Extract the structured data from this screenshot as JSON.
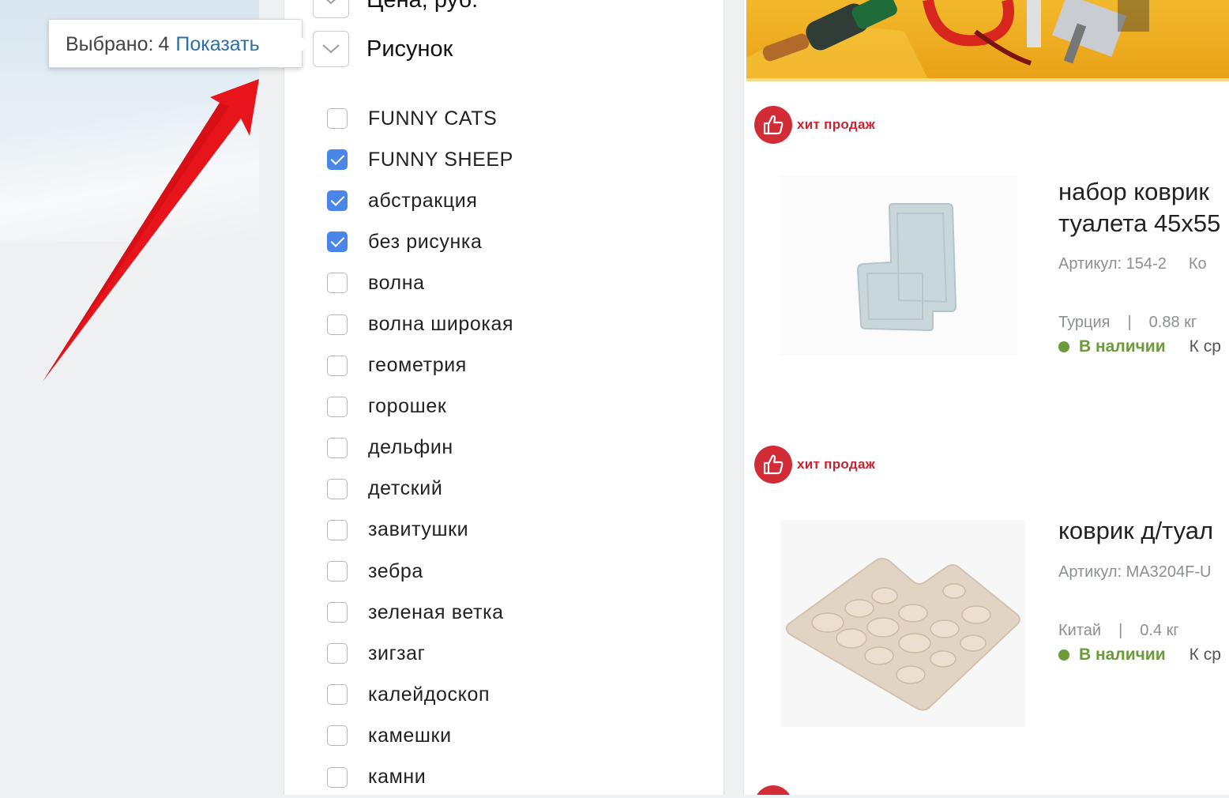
{
  "tooltip": {
    "selected_label": "Выбрано:",
    "selected_count": "4",
    "show_link": "Показать"
  },
  "filter": {
    "prev_section_title": "Цена, руб.",
    "section_title": "Рисунок",
    "options": [
      {
        "label": "FUNNY CATS",
        "checked": false
      },
      {
        "label": "FUNNY SHEEP",
        "checked": true
      },
      {
        "label": "абстракция",
        "checked": true
      },
      {
        "label": "без рисунка",
        "checked": true
      },
      {
        "label": "волна",
        "checked": false
      },
      {
        "label": "волна широкая",
        "checked": false
      },
      {
        "label": "геометрия",
        "checked": false
      },
      {
        "label": "горошек",
        "checked": false
      },
      {
        "label": "дельфин",
        "checked": false
      },
      {
        "label": "детский",
        "checked": false
      },
      {
        "label": "завитушки",
        "checked": false
      },
      {
        "label": "зебра",
        "checked": false
      },
      {
        "label": "зеленая ветка",
        "checked": false
      },
      {
        "label": "зигзаг",
        "checked": false
      },
      {
        "label": "калейдоскоп",
        "checked": false
      },
      {
        "label": "камешки",
        "checked": false
      },
      {
        "label": "камни",
        "checked": false
      }
    ]
  },
  "products": [
    {
      "badge": "хит продаж",
      "title_line1": "набор коврик",
      "title_line2": "туалета 45х55",
      "article": "Артикул: 154-2",
      "article_extra": "Ко",
      "country": "Турция",
      "weight": "0.88 кг",
      "sep": "|",
      "availability": "В наличии",
      "availability_extra": "К ср"
    },
    {
      "badge": "хит продаж",
      "title_line1": "коврик д/туал",
      "article": "Артикул: MA3204F-U",
      "country": "Китай",
      "weight": "0.4 кг",
      "sep": "|",
      "availability": "В наличии",
      "availability_extra": "К ср"
    }
  ],
  "colors": {
    "accent_blue": "#4a86e8",
    "link_blue": "#2b6fa8",
    "hit_red": "#d22c37",
    "in_stock_green": "#6a9a3a"
  },
  "icons": {
    "section_toggle": "chevron-down-icon",
    "hit_badge": "thumbs-up-icon",
    "annotation": "red-arrow"
  }
}
